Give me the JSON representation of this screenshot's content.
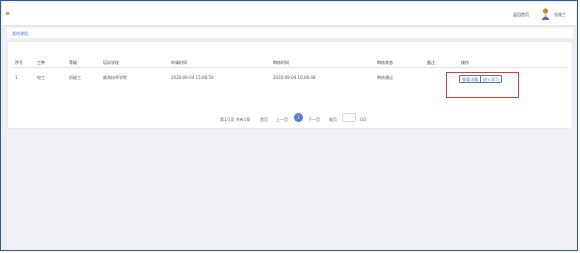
{
  "topbar": {
    "menu_glyph": "≡",
    "home_link": "返回首页",
    "username": "张雅兰"
  },
  "breadcrumb": "我的课程",
  "table": {
    "headers": [
      "序号",
      "工种",
      "等级",
      "培训学校",
      "申请时间",
      "审核时间",
      "审核状态",
      "备注",
      "操作"
    ],
    "rows": [
      {
        "index": "1",
        "trade": "电工",
        "level": "初级工",
        "school": "威海技师学院",
        "apply_time": "2020-09-04 15:06:50",
        "review_time": "2020-09-04 16:06:48",
        "status": "审核通过",
        "remark": "",
        "actions": [
          "查看详情",
          "进入学习"
        ]
      }
    ]
  },
  "pagination": {
    "summary": "第1/1页 共有1条",
    "first": "首页",
    "prev": "上一页",
    "current": "1",
    "next": "下一页",
    "last": "尾页",
    "go": "GO"
  },
  "colors": {
    "accent": "#4a74d8",
    "highlight": "#e03a3a",
    "frame": "#2f56a6"
  }
}
